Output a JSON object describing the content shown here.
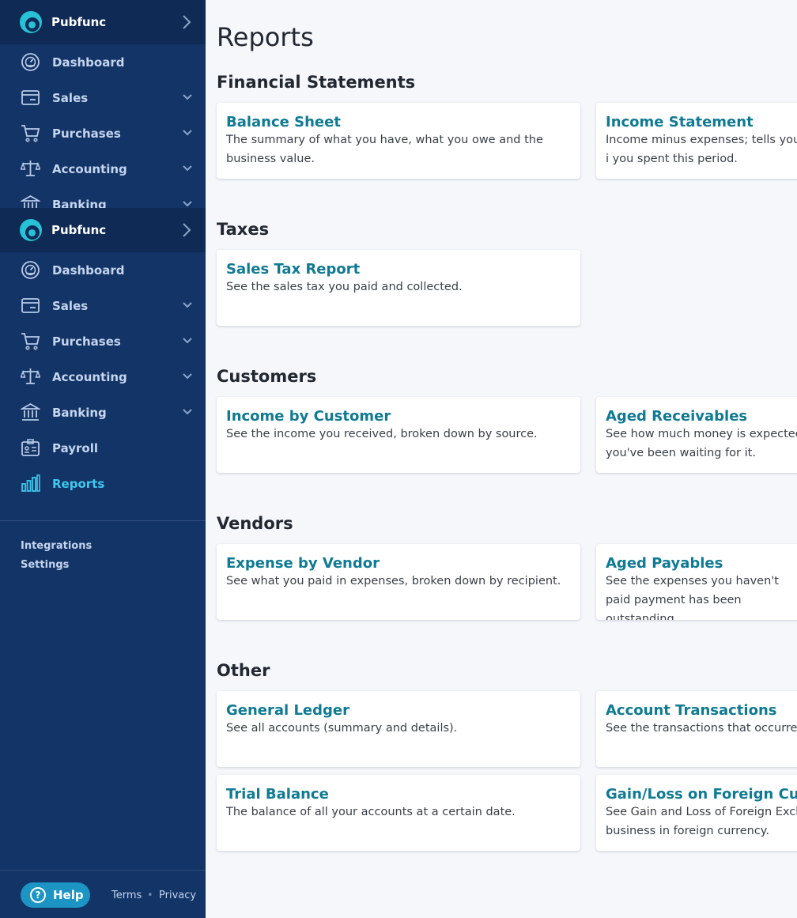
{
  "org": {
    "name": "Pubfunc"
  },
  "nav": [
    {
      "label": "Dashboard",
      "icon": "dashboard-icon"
    },
    {
      "label": "Sales",
      "icon": "sales-icon"
    },
    {
      "label": "Purchases",
      "icon": "cart-icon"
    },
    {
      "label": "Accounting",
      "icon": "scale-icon"
    },
    {
      "label": "Banking",
      "icon": "bank-icon"
    },
    {
      "label": "Payroll",
      "icon": "payroll-icon"
    },
    {
      "label": "Reports",
      "icon": "reports-icon",
      "active": true
    }
  ],
  "secondary_links": [
    "Integrations",
    "Settings"
  ],
  "footer": {
    "help": "Help",
    "terms": "Terms",
    "separator": "•",
    "privacy": "Privacy"
  },
  "page": {
    "title": "Reports",
    "sections": [
      {
        "title": "Financial Statements",
        "cards": [
          {
            "title": "Balance Sheet",
            "desc": "The summary of what you have, what you owe and the business value."
          },
          {
            "title": "Income Statement",
            "desc": "Income minus expenses; tells you i you spent this period."
          }
        ]
      },
      {
        "title": "Taxes",
        "cards": [
          {
            "title": "Sales Tax Report",
            "desc": "See the sales tax you paid and collected."
          }
        ]
      },
      {
        "title": "Customers",
        "cards": [
          {
            "title": "Income by Customer",
            "desc": "See the income you received, broken down by source."
          },
          {
            "title": "Aged Receivables",
            "desc": "See how much money is expected you've been waiting for it."
          }
        ]
      },
      {
        "title": "Vendors",
        "cards": [
          {
            "title": "Expense by Vendor",
            "desc": "See what you paid in expenses, broken down by recipient."
          },
          {
            "title": "Aged Payables",
            "desc": "See the expenses you haven't paid payment has been outstanding."
          }
        ]
      },
      {
        "title": "Other",
        "cards": [
          {
            "title": "General Ledger",
            "desc": "See all accounts (summary and details)."
          },
          {
            "title": "Account Transactions",
            "desc": "See the transactions that occurred"
          },
          {
            "title": "Trial Balance",
            "desc": "The balance of all your accounts at a certain date."
          },
          {
            "title": "Gain/Loss on Foreign Curre",
            "desc": "See Gain and Loss of Foreign Exch business in foreign currency."
          }
        ]
      }
    ]
  },
  "colors": {
    "sidebar": "#133466",
    "active": "#3ec8ee",
    "card_title": "#0e7a93",
    "help": "#1c94c4"
  }
}
